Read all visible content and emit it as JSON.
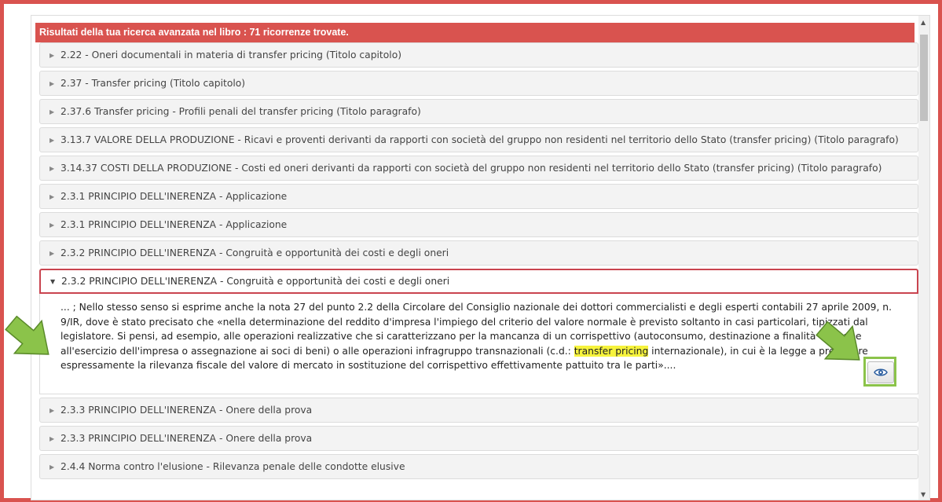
{
  "header": {
    "title": "Risultati della tua ricerca avanzata nel libro : 71 ricorrenze trovate."
  },
  "results": [
    {
      "label": "2.22  - Oneri documentali in materia di transfer pricing (Titolo capitolo)"
    },
    {
      "label": "2.37  - Transfer pricing (Titolo capitolo)"
    },
    {
      "label": "2.37.6 Transfer pricing - Profili penali del transfer pricing (Titolo paragrafo)"
    },
    {
      "label": "3.13.7 VALORE DELLA PRODUZIONE - Ricavi e proventi derivanti da rapporti con società del gruppo non residenti nel territorio dello Stato (transfer pricing) (Titolo paragrafo)"
    },
    {
      "label": "3.14.37 COSTI DELLA PRODUZIONE - Costi ed oneri derivanti da rapporti con società del gruppo non residenti nel territorio dello Stato (transfer pricing) (Titolo paragrafo)"
    },
    {
      "label": "2.3.1 PRINCIPIO DELL'INERENZA - Applicazione"
    },
    {
      "label": "2.3.1 PRINCIPIO DELL'INERENZA - Applicazione"
    },
    {
      "label": "2.3.2 PRINCIPIO DELL'INERENZA - Congruità e opportunità dei costi e degli oneri"
    }
  ],
  "expanded": {
    "label": "2.3.2 PRINCIPIO DELL'INERENZA - Congruità e opportunità dei costi e degli oneri",
    "excerpt_before": "... ; Nello stesso senso si esprime anche la nota 27 del punto 2.2 della Circolare del Consiglio nazionale dei dottori commercialisti e degli esperti contabili 27 aprile 2009, n. 9/IR, dove è stato precisato che «nella determinazione del reddito d'impresa l'impiego del criterio del valore normale è previsto soltanto in casi particolari, tipizzati dal legislatore. Si pensi, ad esempio, alle operazioni realizzative che si caratterizzano per la mancanza di un corrispettivo (autoconsumo, destinazione a finalità estranee all'esercizio dell'impresa o assegnazione ai soci di beni) o alle operazioni infragruppo transnazionali (c.d.: ",
    "excerpt_highlight": "transfer pricing",
    "excerpt_after": " internazionale), in cui è la legge a prevedere espressamente la rilevanza fiscale del valore di mercato in sostituzione del corrispettivo effettivamente pattuito tra le parti»....",
    "view_icon": "eye-icon"
  },
  "results_after": [
    {
      "label": "2.3.3 PRINCIPIO DELL'INERENZA - Onere della prova"
    },
    {
      "label": "2.3.3 PRINCIPIO DELL'INERENZA - Onere della prova"
    },
    {
      "label": "2.4.4 Norma contro l'elusione - Rilevanza penale delle condotte elusive"
    }
  ],
  "colors": {
    "accent": "#d9534f",
    "highlight": "#f6f33c",
    "annotation": "#8bc34a"
  }
}
